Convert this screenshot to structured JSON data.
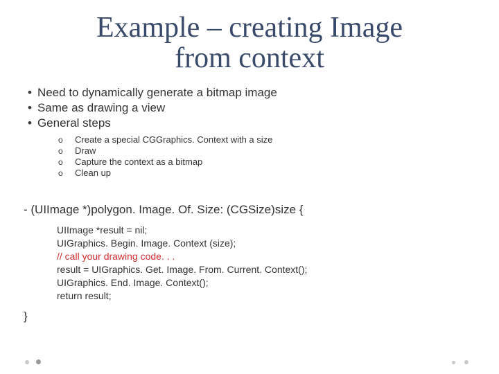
{
  "title_line1": "Example – creating Image",
  "title_line2": "from context",
  "bullets": {
    "b1": "Need to dynamically generate a bitmap image",
    "b2": "Same as drawing a view",
    "b3": "General steps"
  },
  "steps": {
    "s1": "Create a special CGGraphics. Context with a size",
    "s2": "Draw",
    "s3": "Capture the context as a bitmap",
    "s4": "Clean up"
  },
  "method_sig": "- (UIImage *)polygon. Image. Of. Size: (CGSize)size {",
  "code": {
    "l1": "UIImage *result = nil;",
    "l2": "UIGraphics. Begin. Image. Context (size);",
    "l3": "// call your drawing code. . .",
    "l4": "result = UIGraphics. Get. Image. From. Current. Context();",
    "l5": "UIGraphics. End. Image. Context();",
    "l6": "return result;"
  },
  "close": "}"
}
